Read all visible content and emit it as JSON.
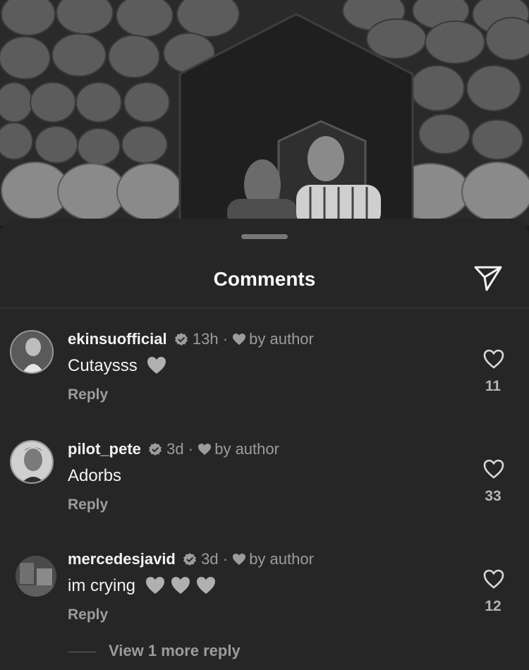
{
  "sheet": {
    "title": "Comments",
    "share_icon": "paper-plane-icon"
  },
  "comments": [
    {
      "username": "ekinsuofficial",
      "time": "13h",
      "liked_by": "by author",
      "text": "Cutaysss",
      "emoji_count": 1,
      "reply_label": "Reply",
      "likes": "11"
    },
    {
      "username": "pilot_pete",
      "time": "3d",
      "liked_by": "by author",
      "text": "Adorbs",
      "emoji_count": 0,
      "reply_label": "Reply",
      "likes": "33"
    },
    {
      "username": "mercedesjavid",
      "time": "3d",
      "liked_by": "by author",
      "text": "im crying",
      "emoji_count": 3,
      "reply_label": "Reply",
      "likes": "12"
    }
  ],
  "view_more_label": "View 1 more reply",
  "colors": {
    "sheet_bg": "#262626",
    "text_primary": "#f2f2f2",
    "text_secondary": "#9c9c9c",
    "emoji_heart": "#b0b0b0"
  }
}
